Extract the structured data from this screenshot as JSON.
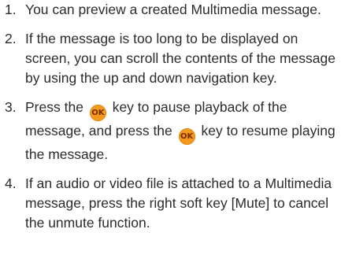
{
  "steps": [
    {
      "number": "1.",
      "text": "You can preview a created Multimedia message."
    },
    {
      "number": "2.",
      "text": "If the message is too long to be displayed on screen, you can scroll the contents of the message by using the up and down navigation key."
    },
    {
      "number": "3.",
      "text_a": "Press the",
      "text_b": "key to pause playback of the message, and press the",
      "text_c": "key to resume playing the message."
    },
    {
      "number": "4.",
      "text": "If an audio or video file is attached to a Multimedia message, press the right soft key [Mute] to cancel the unmute function."
    }
  ],
  "ok_key_label": "OK",
  "colors": {
    "text": "#2b2b2b",
    "ok_key": "#f39a1e"
  }
}
